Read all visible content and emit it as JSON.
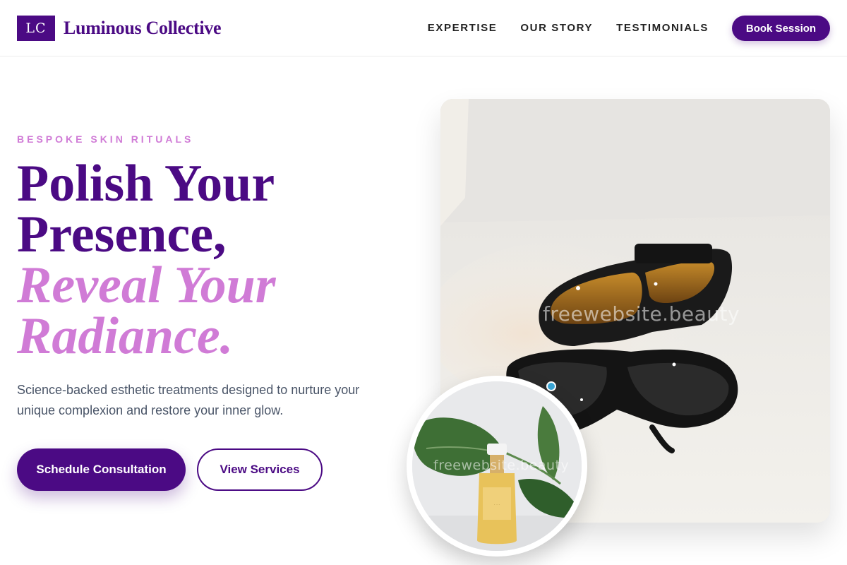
{
  "brand": {
    "logo_initials": "LC",
    "name": "Luminous Collective",
    "color": "#4b0a84"
  },
  "nav": {
    "items": [
      "EXPERTISE",
      "OUR STORY",
      "TESTIMONIALS"
    ],
    "cta": "Book Session"
  },
  "hero": {
    "eyebrow": "BESPOKE SKIN RITUALS",
    "headline": {
      "line1": "Polish Your",
      "line2": "Presence,",
      "line3": "Reveal Your",
      "line4": "Radiance."
    },
    "subtitle": "Science-backed esthetic treatments designed to nurture your unique complexion and restore your inner glow.",
    "primary_button": "Schedule Consultation",
    "secondary_button": "View Services"
  },
  "images": {
    "main_watermark": "freewebsite.beauty",
    "inset_watermark": "freewebsite.beauty"
  },
  "colors": {
    "accent": "#d07bd6",
    "primary": "#4b0a84"
  }
}
